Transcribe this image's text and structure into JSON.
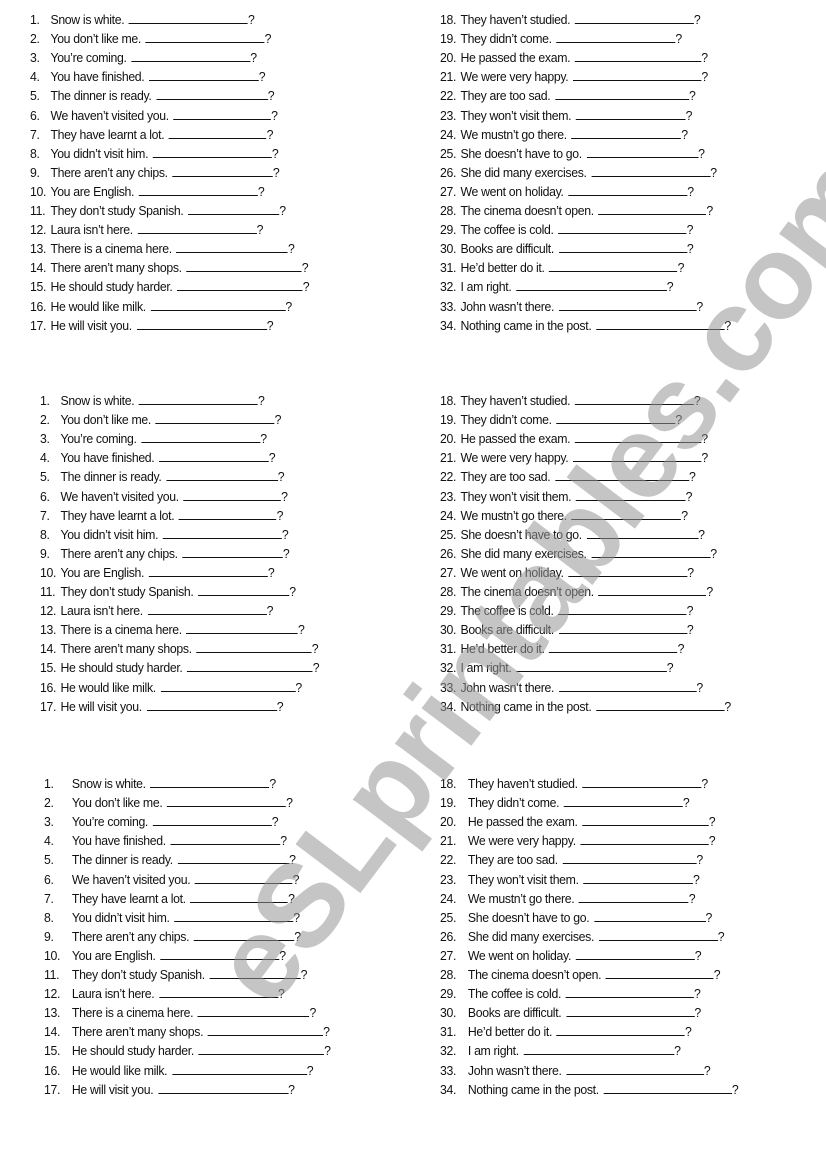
{
  "watermark": "eSLprintables.com",
  "items_left": [
    {
      "n": "1.",
      "text": "Snow is white."
    },
    {
      "n": "2.",
      "text": "You don’t like me."
    },
    {
      "n": "3.",
      "text": "You’re coming."
    },
    {
      "n": "4.",
      "text": "You have finished."
    },
    {
      "n": "5.",
      "text": "The dinner is ready."
    },
    {
      "n": "6.",
      "text": "We haven’t visited you."
    },
    {
      "n": "7.",
      "text": "They have learnt a lot."
    },
    {
      "n": "8.",
      "text": "You didn’t visit him."
    },
    {
      "n": "9.",
      "text": "There aren’t any chips."
    },
    {
      "n": "10.",
      "text": "You are English."
    },
    {
      "n": "11.",
      "text": "They don’t study Spanish."
    },
    {
      "n": "12.",
      "text": "Laura isn’t here."
    },
    {
      "n": "13.",
      "text": "There is a cinema here."
    },
    {
      "n": "14.",
      "text": "There aren’t many shops."
    },
    {
      "n": "15.",
      "text": "He should study harder."
    },
    {
      "n": "16.",
      "text": "He would like milk."
    },
    {
      "n": "17.",
      "text": "He will visit you."
    }
  ],
  "items_right": [
    {
      "n": "18.",
      "text": "They haven’t studied."
    },
    {
      "n": "19.",
      "text": "They didn’t come."
    },
    {
      "n": "20.",
      "text": "He passed the exam."
    },
    {
      "n": "21.",
      "text": "We were very happy."
    },
    {
      "n": "22.",
      "text": "They are too sad."
    },
    {
      "n": "23.",
      "text": "They won’t visit them."
    },
    {
      "n": "24.",
      "text": "We mustn’t go there."
    },
    {
      "n": "25.",
      "text": "She doesn’t have to go."
    },
    {
      "n": "26.",
      "text": "She did many exercises."
    },
    {
      "n": "27.",
      "text": "We went on holiday."
    },
    {
      "n": "28.",
      "text": "The cinema doesn’t open."
    },
    {
      "n": "29.",
      "text": "The coffee is cold."
    },
    {
      "n": "30.",
      "text": "Books are difficult."
    },
    {
      "n": "31.",
      "text": "He’d better do it."
    },
    {
      "n": "32.",
      "text": "I am right."
    },
    {
      "n": "33.",
      "text": "John wasn’t there."
    },
    {
      "n": "34.",
      "text": "Nothing came in the post."
    }
  ],
  "blank_suffix": "?"
}
